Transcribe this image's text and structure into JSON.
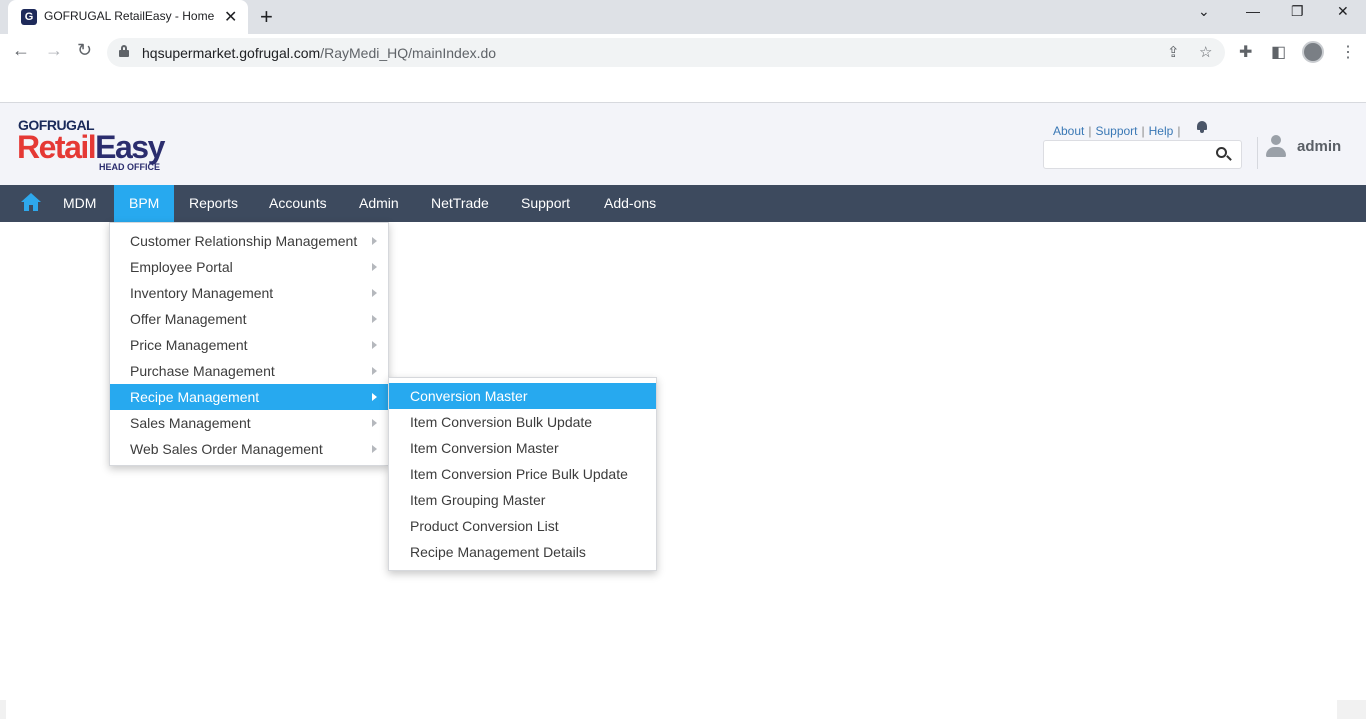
{
  "browser": {
    "tab_title": "GOFRUGAL RetailEasy - Home",
    "favicon_letter": "G",
    "url_host": "hqsupermarket.gofrugal.com",
    "url_path": "/RayMedi_HQ/mainIndex.do"
  },
  "header": {
    "logo_top": "GOFRUGAL",
    "logo_retail": "Retail",
    "logo_easy": "Easy",
    "logo_sub": "HEAD OFFICE",
    "links": [
      "About",
      "Support",
      "Help"
    ],
    "search_placeholder": "",
    "username": "admin"
  },
  "nav": {
    "items": [
      "MDM",
      "BPM",
      "Reports",
      "Accounts",
      "Admin",
      "NetTrade",
      "Support",
      "Add-ons"
    ],
    "active": "BPM"
  },
  "bpm_menu": [
    "Customer Relationship Management",
    "Employee Portal",
    "Inventory Management",
    "Offer Management",
    "Price Management",
    "Purchase Management",
    "Recipe Management",
    "Sales Management",
    "Web Sales Order Management"
  ],
  "recipe_submenu": [
    "Conversion Master",
    "Item Conversion Bulk Update",
    "Item Conversion Master",
    "Item Conversion Price Bulk Update",
    "Item Grouping Master",
    "Product Conversion List",
    "Recipe Management Details"
  ],
  "colors": {
    "accent": "#27a9ef",
    "navbar": "#3d4a5e",
    "brand_red": "#e53935",
    "brand_navy": "#2b2d6e"
  }
}
